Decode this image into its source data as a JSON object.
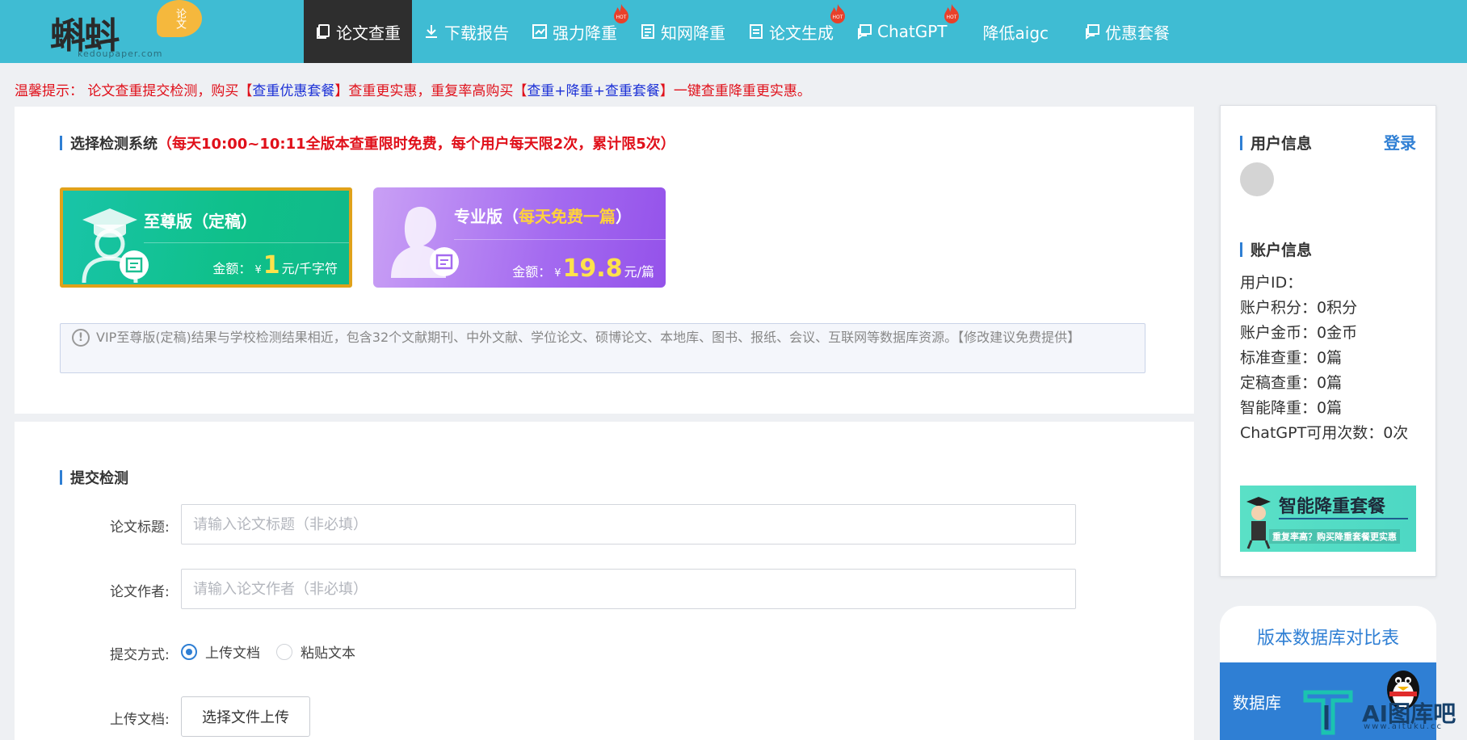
{
  "header": {
    "logo_text": "蝌蚪",
    "logo_badge": "论文",
    "logo_domain": "kedoupaper.com",
    "nav": [
      {
        "label": "论文查重",
        "icon": "document-copy-icon",
        "hot": false,
        "active": true
      },
      {
        "label": "下载报告",
        "icon": "download-icon",
        "hot": false,
        "active": false
      },
      {
        "label": "强力降重",
        "icon": "chart-icon",
        "hot": true,
        "active": false
      },
      {
        "label": "知网降重",
        "icon": "document-list-icon",
        "hot": false,
        "active": false
      },
      {
        "label": "论文生成",
        "icon": "document-edit-icon",
        "hot": true,
        "active": false
      },
      {
        "label": "ChatGPT",
        "icon": "chat-icon",
        "hot": true,
        "active": false
      },
      {
        "label": "降低aigc",
        "icon": "",
        "hot": false,
        "active": false
      },
      {
        "label": "优惠套餐",
        "icon": "chat-icon",
        "hot": false,
        "active": false
      }
    ],
    "hot_badge": "HOT"
  },
  "notice": {
    "prefix": "温馨提示：  论文查重提交检测，购买【",
    "link1": "查重优惠套餐",
    "middle": "】查重更实惠，重复率高购买【",
    "link2": "查重+降重+查重套餐",
    "suffix": "】一键查重降重更实惠。"
  },
  "detect": {
    "title": "选择检测系统",
    "promo": "（每天10:00~10:11全版本查重限时免费，每个用户每天限2次，累计限5次）",
    "cards": [
      {
        "name": "至尊版（定稿）",
        "highlight": "",
        "price_label": "金额：",
        "currency": "¥",
        "price": "1",
        "unit": "元/千字符"
      },
      {
        "name": "专业版（",
        "highlight": "每天免费一篇",
        "name_end": "）",
        "price_label": "金额：",
        "currency": "¥",
        "price": "19.8",
        "unit": "元/篇"
      }
    ],
    "info": "VIP至尊版(定稿)结果与学校检测结果相近，包含32个文献期刊、中外文献、学位论文、硕博论文、本地库、图书、报纸、会议、互联网等数据库资源。【修改建议免费提供】"
  },
  "submit": {
    "title": "提交检测",
    "title_label": "论文标题:",
    "title_placeholder": "请输入论文标题（非必填）",
    "author_label": "论文作者:",
    "author_placeholder": "请输入论文作者（非必填）",
    "method_label": "提交方式:",
    "method_options": [
      "上传文档",
      "粘贴文本"
    ],
    "method_selected": "上传文档",
    "upload_label": "上传文档:",
    "upload_button": "选择文件上传"
  },
  "sidebar": {
    "user_title": "用户信息",
    "login": "登录",
    "account_title": "账户信息",
    "account": [
      "用户ID：",
      "账户积分：0积分",
      "账户金币：0金币",
      "标准查重：0篇",
      "定稿查重：0篇",
      "智能降重：0篇",
      "ChatGPT可用次数：0次"
    ],
    "banner_title": "智能降重套餐",
    "banner_sub": "重复率高？购买降重套餐更实惠"
  },
  "compare": {
    "title": "版本数据库对比表",
    "col_header": "数据库"
  },
  "watermark": {
    "text": "AI图库吧",
    "url": "www.aituku.cc"
  },
  "colors": {
    "nav_bg": "#3fbcd3",
    "nav_active": "#2e2e2e",
    "accent_blue": "#2f7fd4",
    "notice_red": "#e0101a",
    "card1_green": "#0fc089",
    "card2_purple": "#a46af0",
    "price_yellow": "#ffe24a"
  }
}
